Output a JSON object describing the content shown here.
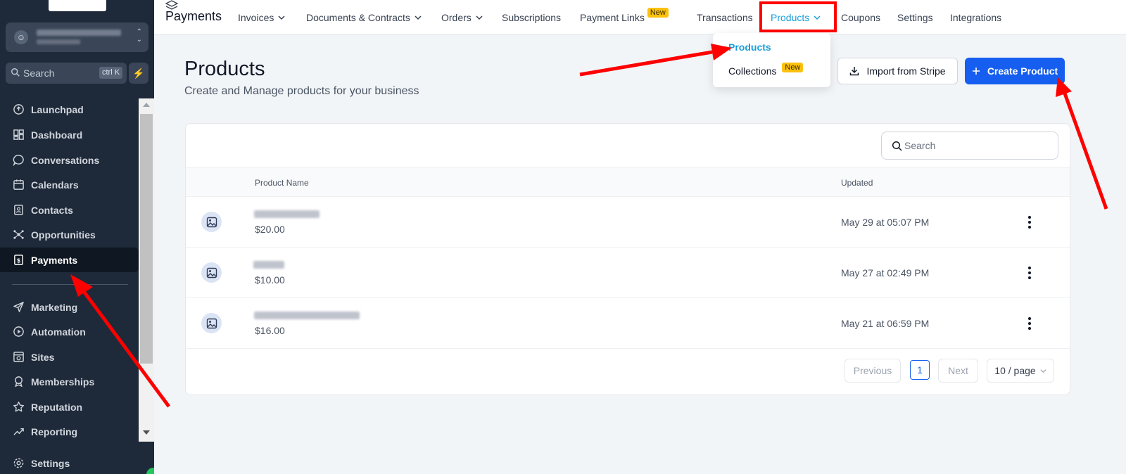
{
  "sidebar": {
    "search_label": "Search",
    "search_shortcut": "ctrl K",
    "items": [
      {
        "label": "Launchpad",
        "icon": "launchpad-icon"
      },
      {
        "label": "Dashboard",
        "icon": "dashboard-icon"
      },
      {
        "label": "Conversations",
        "icon": "chat-icon"
      },
      {
        "label": "Calendars",
        "icon": "calendar-icon"
      },
      {
        "label": "Contacts",
        "icon": "contacts-icon"
      },
      {
        "label": "Opportunities",
        "icon": "opportunities-icon"
      },
      {
        "label": "Payments",
        "icon": "payments-icon",
        "active": true
      },
      {
        "label": "Marketing",
        "icon": "send-icon"
      },
      {
        "label": "Automation",
        "icon": "automation-icon"
      },
      {
        "label": "Sites",
        "icon": "sites-icon"
      },
      {
        "label": "Memberships",
        "icon": "memberships-icon"
      },
      {
        "label": "Reputation",
        "icon": "star-icon"
      },
      {
        "label": "Reporting",
        "icon": "chart-icon"
      },
      {
        "label": "Settings",
        "icon": "gear-icon"
      }
    ]
  },
  "topbar": {
    "title": "Payments",
    "tabs": [
      {
        "label": "Invoices",
        "dropdown": true
      },
      {
        "label": "Documents & Contracts",
        "dropdown": true
      },
      {
        "label": "Orders",
        "dropdown": true
      },
      {
        "label": "Subscriptions"
      },
      {
        "label": "Payment Links",
        "badge": "New"
      },
      {
        "label": "Transactions"
      },
      {
        "label": "Products",
        "dropdown": true,
        "active": true
      },
      {
        "label": "Coupons"
      },
      {
        "label": "Settings"
      },
      {
        "label": "Integrations"
      }
    ]
  },
  "dropdown": {
    "items": [
      {
        "label": "Products",
        "selected": true
      },
      {
        "label": "Collections",
        "badge": "New"
      }
    ]
  },
  "page": {
    "title": "Products",
    "subtitle": "Create and Manage products for your business",
    "import_label": "Import from Stripe",
    "create_label": "Create Product"
  },
  "table": {
    "search_placeholder": "Search",
    "columns": [
      "Product Name",
      "Updated"
    ],
    "rows": [
      {
        "price": "$20.00",
        "updated": "May 29 at 05:07 PM"
      },
      {
        "price": "$10.00",
        "updated": "May 27 at 02:49 PM"
      },
      {
        "price": "$16.00",
        "updated": "May 21 at 06:59 PM"
      }
    ],
    "pagination": {
      "previous": "Previous",
      "current_page": "1",
      "next": "Next",
      "page_size": "10 / page"
    }
  },
  "colors": {
    "sidebar_bg": "#1e2939",
    "accent_blue": "#155eef",
    "active_tab": "#1a9fd9",
    "badge_new": "#fcc10d",
    "annotation_red": "#ff0000"
  }
}
